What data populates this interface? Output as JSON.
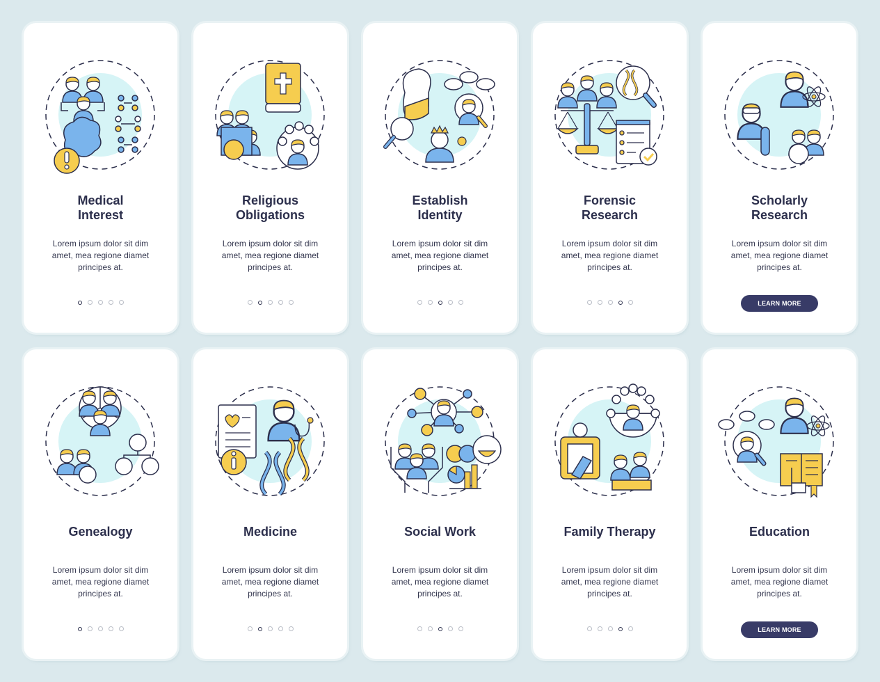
{
  "colors": {
    "background": "#dbe9ed",
    "card": "#ffffff",
    "heading": "#2c2f4c",
    "button": "#383b67",
    "accent_yellow": "#f6cd4f",
    "accent_blue": "#7ab4ec",
    "accent_cyan": "#d6f4f6"
  },
  "cards": [
    {
      "title_line1": "Medical",
      "title_line2": "Interest",
      "description": "Lorem ipsum dolor sit dim amet, mea regione diamet principes at.",
      "icon": "medical-interest-icon",
      "active_page": 1,
      "total_pages": 5
    },
    {
      "title_line1": "Religious",
      "title_line2": "Obligations",
      "description": "Lorem ipsum dolor sit dim amet, mea regione diamet principes at.",
      "icon": "religious-obligations-icon",
      "active_page": 2,
      "total_pages": 5
    },
    {
      "title_line1": "Establish",
      "title_line2": "Identity",
      "description": "Lorem ipsum dolor sit dim amet, mea regione diamet principes at.",
      "icon": "establish-identity-icon",
      "active_page": 3,
      "total_pages": 5
    },
    {
      "title_line1": "Forensic",
      "title_line2": "Research",
      "description": "Lorem ipsum dolor sit dim amet, mea regione diamet principes at.",
      "icon": "forensic-research-icon",
      "active_page": 4,
      "total_pages": 5
    },
    {
      "title_line1": "Scholarly",
      "title_line2": "Research",
      "description": "Lorem ipsum dolor sit dim amet, mea regione diamet principes at.",
      "icon": "scholarly-research-icon",
      "button_label": "LEARN MORE"
    },
    {
      "title_line1": "Genealogy",
      "description": "Lorem ipsum dolor sit dim amet, mea regione diamet principes at.",
      "icon": "genealogy-icon",
      "active_page": 1,
      "total_pages": 5
    },
    {
      "title_line1": "Medicine",
      "description": "Lorem ipsum dolor sit dim amet, mea regione diamet principes at.",
      "icon": "medicine-icon",
      "active_page": 2,
      "total_pages": 5
    },
    {
      "title_line1": "Social Work",
      "description": "Lorem ipsum dolor sit dim amet, mea regione diamet principes at.",
      "icon": "social-work-icon",
      "active_page": 3,
      "total_pages": 5
    },
    {
      "title_line1": "Family Therapy",
      "description": "Lorem ipsum dolor sit dim amet, mea regione diamet principes at.",
      "icon": "family-therapy-icon",
      "active_page": 4,
      "total_pages": 5
    },
    {
      "title_line1": "Education",
      "description": "Lorem ipsum dolor sit dim amet, mea regione diamet principes at.",
      "icon": "education-icon",
      "button_label": "LEARN MORE"
    }
  ]
}
